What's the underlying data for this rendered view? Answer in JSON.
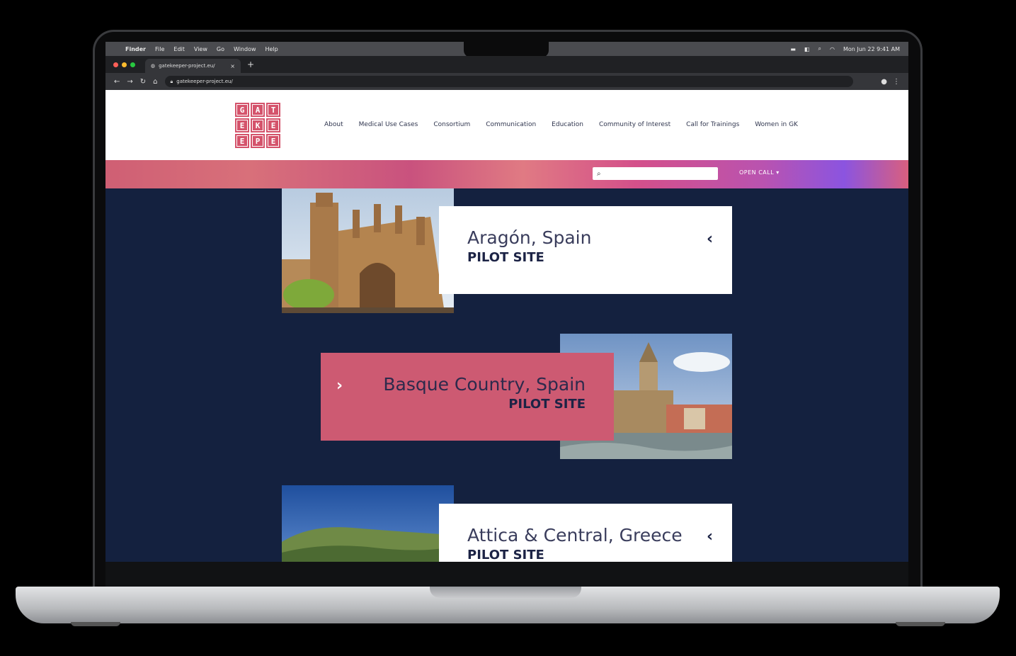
{
  "menubar": {
    "apple": "",
    "items": [
      "Finder",
      "File",
      "Edit",
      "View",
      "Go",
      "Window",
      "Help"
    ],
    "datetime": "Mon Jun 22  9:41 AM"
  },
  "browser": {
    "tab_title": "gatekeeper-project.eu/",
    "tab_close": "×",
    "new_tab": "+",
    "url": "gatekeeper-project.eu/",
    "colors": {
      "red": "#ff5f57",
      "yellow": "#febc2e",
      "green": "#28c840"
    }
  },
  "logo": {
    "letters": [
      "G",
      "A",
      "T",
      "E",
      "K",
      "E",
      "E",
      "P",
      "E",
      "R"
    ]
  },
  "nav": {
    "items": [
      "About",
      "Medical Use Cases",
      "Consortium",
      "Communication",
      "Education",
      "Community of Interest",
      "Call for Trainings",
      "Women in GK"
    ]
  },
  "band": {
    "open_call": "OPEN CALL ▾",
    "search_placeholder": ""
  },
  "sites": [
    {
      "title": "Aragón, Spain",
      "subtitle": "PILOT SITE",
      "chevron": "‹"
    },
    {
      "title": "Basque Country, Spain",
      "subtitle": "PILOT SITE",
      "chevron": "›"
    },
    {
      "title": "Attica & Central, Greece",
      "subtitle": "PILOT SITE",
      "chevron": "‹"
    }
  ],
  "colors": {
    "accent": "#cd5a72",
    "navy": "#14213f"
  }
}
